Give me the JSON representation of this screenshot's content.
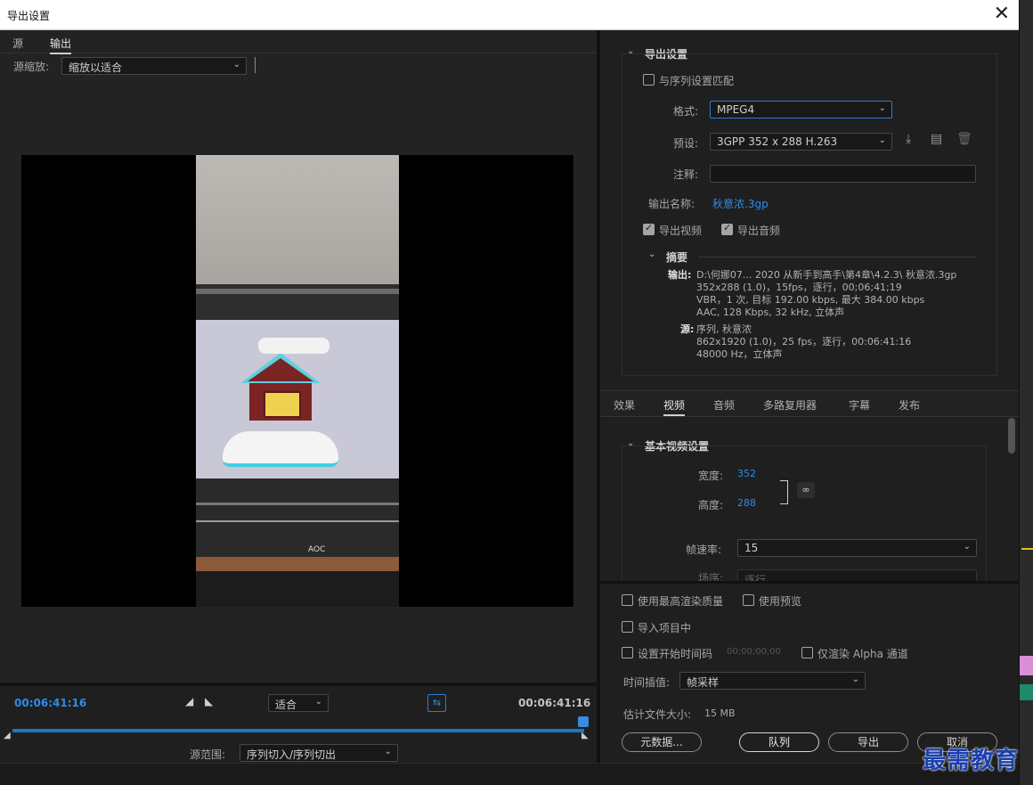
{
  "window": {
    "title": "导出设置",
    "close_icon": "close-icon"
  },
  "left": {
    "tabs": [
      "源",
      "输出"
    ],
    "source_scale_label": "源缩放:",
    "source_scale_value": "缩放以适合",
    "timecode_left": "00:06:41:16",
    "timecode_right": "00:06:41:16",
    "fit_value": "适合",
    "source_range_label": "源范围:",
    "source_range_value": "序列切入/序列切出",
    "preview_caption": "AOC"
  },
  "export": {
    "section_title": "导出设置",
    "match_sequence_label": "与序列设置匹配",
    "format_label": "格式:",
    "format_value": "MPEG4",
    "preset_label": "预设:",
    "preset_value": "3GPP 352 x 288 H.263",
    "comment_label": "注释:",
    "output_name_label": "输出名称:",
    "output_name_value": "秋意浓.3gp",
    "export_video_label": "导出视频",
    "export_audio_label": "导出音频",
    "summary_title": "摘要",
    "summary_output_label": "输出:",
    "summary_output_lines": [
      "D:\\何娜07... 2020 从新手到高手\\第4章\\4.2.3\\ 秋意浓.3gp",
      "352x288 (1.0)，15fps，逐行，00;06;41;19",
      "VBR，1 次, 目标 192.00 kbps, 最大 384.00 kbps",
      "AAC, 128 Kbps, 32  kHz, 立体声"
    ],
    "summary_source_label": "源:",
    "summary_source_lines": [
      "序列, 秋意浓",
      "862x1920 (1.0)，25 fps，逐行，00:06:41:16",
      "48000 Hz，立体声"
    ]
  },
  "tabs": [
    "效果",
    "视频",
    "音频",
    "多路复用器",
    "字幕",
    "发布"
  ],
  "video": {
    "section_title": "基本视频设置",
    "width_label": "宽度:",
    "width_value": "352",
    "height_label": "高度:",
    "height_value": "288",
    "framerate_label": "帧速率:",
    "framerate_value": "15",
    "field_order_label": "场序:",
    "field_order_value": "逐行"
  },
  "bottom": {
    "max_render_label": "使用最高渲染质量",
    "use_preview_label": "使用预览",
    "import_project_label": "导入项目中",
    "start_timecode_label": "设置开始时间码",
    "start_timecode_value": "00;00;00;00",
    "alpha_only_label": "仅渲染 Alpha 通道",
    "time_interp_label": "时间插值:",
    "time_interp_value": "帧采样",
    "est_size_label": "估计文件大小:",
    "est_size_value": "15 MB",
    "metadata_button": "元数据...",
    "queue_button": "队列",
    "export_button": "导出",
    "cancel_button": "取消"
  },
  "watermark": "最需教育",
  "colors": {
    "accent": "#2d8ceb",
    "timeline": "#1a78c8"
  }
}
